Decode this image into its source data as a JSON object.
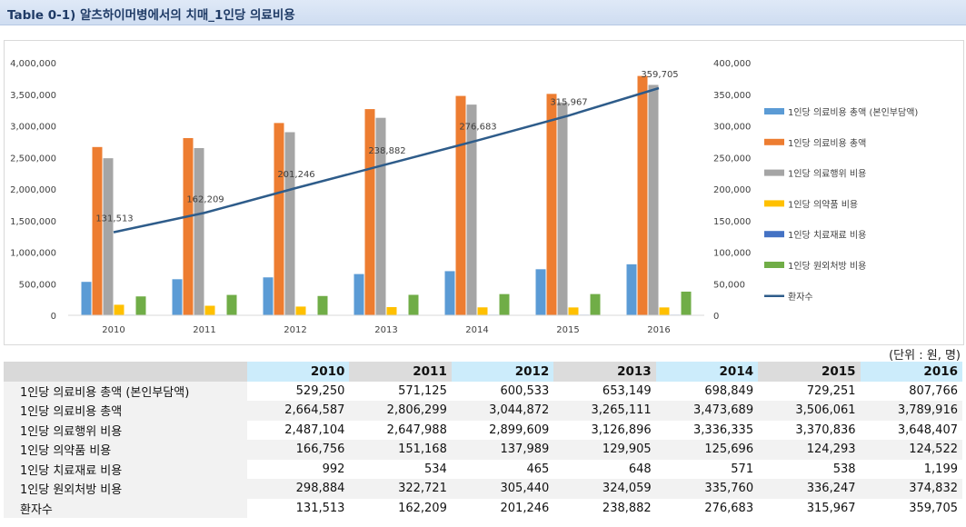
{
  "page_title": "Table 0-1) 알츠하이머병에서의 치매_1인당 의료비용",
  "unit_note": "(단위 : 원, 명)",
  "colors": {
    "s0": "#5b9bd5",
    "s1": "#ed7d31",
    "s2": "#a5a5a5",
    "s3": "#ffc000",
    "s4": "#4472c4",
    "s5": "#70ad47",
    "line": "#2e5c8a"
  },
  "chart_data": {
    "type": "bar",
    "categories": [
      "2010",
      "2011",
      "2012",
      "2013",
      "2014",
      "2015",
      "2016"
    ],
    "ylim_left": [
      0,
      4000000
    ],
    "yticks_left": [
      "0",
      "500,000",
      "1,000,000",
      "1,500,000",
      "2,000,000",
      "2,500,000",
      "3,000,000",
      "3,500,000",
      "4,000,000"
    ],
    "ylim_right": [
      0,
      400000
    ],
    "yticks_right": [
      "0",
      "50,000",
      "100,000",
      "150,000",
      "200,000",
      "250,000",
      "300,000",
      "350,000",
      "400,000"
    ],
    "legend_position": "right",
    "grid": false,
    "series": [
      {
        "name": "1인당 의료비용 총액 (본인부담액)",
        "type": "bar",
        "axis": "left",
        "values": [
          529250,
          571125,
          600533,
          653149,
          698849,
          729251,
          807766
        ]
      },
      {
        "name": "1인당 의료비용 총액",
        "type": "bar",
        "axis": "left",
        "values": [
          2664587,
          2806299,
          3044872,
          3265111,
          3473689,
          3506061,
          3789916
        ]
      },
      {
        "name": "1인당 의료행위 비용",
        "type": "bar",
        "axis": "left",
        "values": [
          2487104,
          2647988,
          2899609,
          3126896,
          3336335,
          3370836,
          3648407
        ]
      },
      {
        "name": "1인당 의약품 비용",
        "type": "bar",
        "axis": "left",
        "values": [
          166756,
          151168,
          137989,
          129905,
          125696,
          124293,
          124522
        ]
      },
      {
        "name": "1인당 치료재료 비용",
        "type": "bar",
        "axis": "left",
        "values": [
          992,
          534,
          465,
          648,
          571,
          538,
          1199
        ]
      },
      {
        "name": "1인당 원외처방 비용",
        "type": "bar",
        "axis": "left",
        "values": [
          298884,
          322721,
          305440,
          324059,
          335760,
          336247,
          374832
        ]
      },
      {
        "name": "환자수",
        "type": "line",
        "axis": "right",
        "values": [
          131513,
          162209,
          201246,
          238882,
          276683,
          315967,
          359705
        ],
        "labels": [
          "131,513",
          "162,209",
          "201,246",
          "238,882",
          "276,683",
          "315,967",
          "359,705"
        ]
      }
    ]
  },
  "table": {
    "headers": [
      "2010",
      "2011",
      "2012",
      "2013",
      "2014",
      "2015",
      "2016"
    ],
    "rows": [
      {
        "label": "1인당 의료비용 총액 (본인부담액)",
        "values": [
          "529,250",
          "571,125",
          "600,533",
          "653,149",
          "698,849",
          "729,251",
          "807,766"
        ]
      },
      {
        "label": "1인당 의료비용 총액",
        "values": [
          "2,664,587",
          "2,806,299",
          "3,044,872",
          "3,265,111",
          "3,473,689",
          "3,506,061",
          "3,789,916"
        ]
      },
      {
        "label": "1인당 의료행위 비용",
        "values": [
          "2,487,104",
          "2,647,988",
          "2,899,609",
          "3,126,896",
          "3,336,335",
          "3,370,836",
          "3,648,407"
        ]
      },
      {
        "label": "1인당 의약품 비용",
        "values": [
          "166,756",
          "151,168",
          "137,989",
          "129,905",
          "125,696",
          "124,293",
          "124,522"
        ]
      },
      {
        "label": "1인당 치료재료 비용",
        "values": [
          "992",
          "534",
          "465",
          "648",
          "571",
          "538",
          "1,199"
        ]
      },
      {
        "label": "1인당 원외처방 비용",
        "values": [
          "298,884",
          "322,721",
          "305,440",
          "324,059",
          "335,760",
          "336,247",
          "374,832"
        ]
      },
      {
        "label": "환자수",
        "values": [
          "131,513",
          "162,209",
          "201,246",
          "238,882",
          "276,683",
          "315,967",
          "359,705"
        ]
      }
    ]
  }
}
